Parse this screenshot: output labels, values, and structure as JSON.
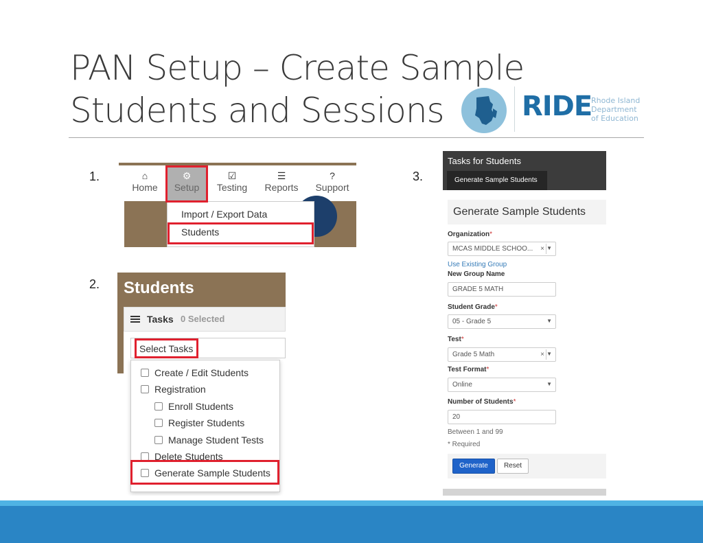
{
  "slide": {
    "title_line1": "PAN Setup – Create Sample",
    "title_line2": "Students and Sessions"
  },
  "logo": {
    "word": "RIDE",
    "sub": [
      "Rhode Island",
      "Department",
      "of Education"
    ]
  },
  "steps": [
    "1.",
    "2.",
    "3."
  ],
  "panel1": {
    "nav": [
      {
        "label": "Home",
        "icon": "home-icon",
        "glyph": "⌂"
      },
      {
        "label": "Setup",
        "icon": "gear-icon",
        "glyph": "⚙"
      },
      {
        "label": "Testing",
        "icon": "check-square-icon",
        "glyph": "☑"
      },
      {
        "label": "Reports",
        "icon": "server-icon",
        "glyph": "☰"
      },
      {
        "label": "Support",
        "icon": "question-circle-icon",
        "glyph": "?"
      }
    ],
    "dropdown": [
      "Import / Export Data",
      "Students"
    ]
  },
  "panel2": {
    "title": "Students",
    "tasks_label": "Tasks",
    "selected": "0 Selected",
    "select_tasks": "Select Tasks",
    "menu": [
      {
        "label": "Create / Edit Students"
      },
      {
        "label": "Registration"
      },
      {
        "label": "Enroll Students"
      },
      {
        "label": "Register Students"
      },
      {
        "label": "Manage Student Tests"
      },
      {
        "label": "Delete Students"
      },
      {
        "label": "Generate Sample Students"
      }
    ]
  },
  "panel3": {
    "header": "Tasks for Students",
    "tab": "Generate Sample Students",
    "form_title": "Generate Sample Students",
    "organization_label": "Organization",
    "organization_value": "MCAS MIDDLE SCHOO...",
    "use_existing_group": "Use Existing Group",
    "new_group_label": "New Group Name",
    "new_group_value": "GRADE 5 MATH",
    "grade_label": "Student Grade",
    "grade_value": "05 - Grade 5",
    "test_label": "Test",
    "test_value": "Grade 5 Math",
    "format_label": "Test Format",
    "format_value": "Online",
    "count_label": "Number of Students",
    "count_value": "20",
    "count_help": "Between 1 and 99",
    "required_note": "* Required",
    "generate_label": "Generate",
    "reset_label": "Reset",
    "required_mark": "*"
  },
  "colors": {
    "highlight": "#e0202e",
    "brand_brown": "#8b7355",
    "band_blue": "#2a85c5",
    "band_light": "#4fb3e4",
    "ride_blue": "#1f6ea6"
  }
}
